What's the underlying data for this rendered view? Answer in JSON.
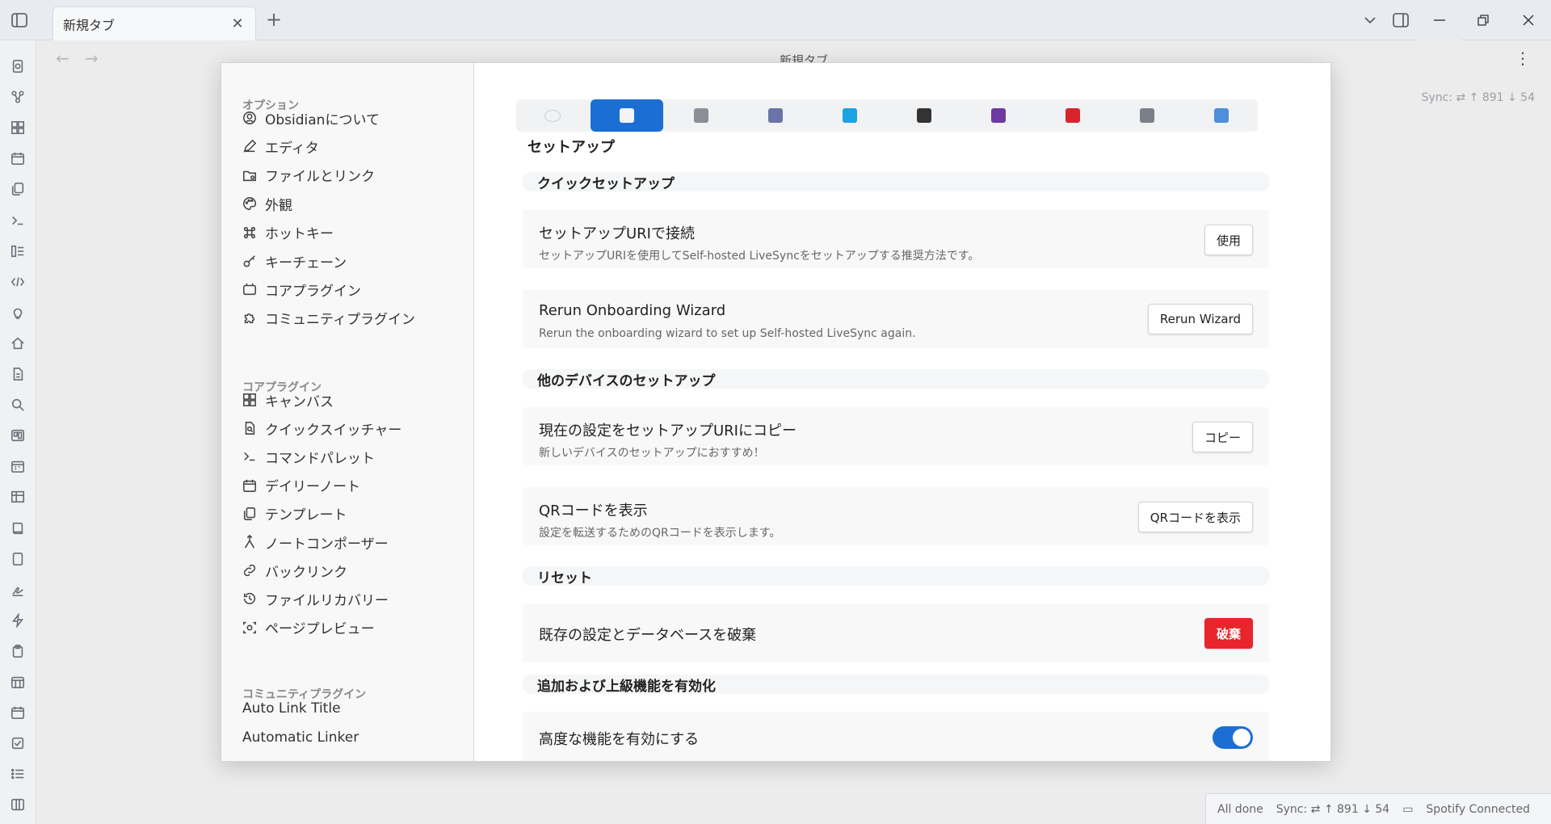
{
  "window": {
    "tab_title": "新規タブ",
    "view_title": "新規タブ"
  },
  "status": {
    "sync_top": "Sync: ⇄ ↑ 891 ↓ 54",
    "all_done": "All done",
    "sync_bottom": "Sync: ⇄ ↑ 891 ↓ 54",
    "spotify": "Spotify Connected"
  },
  "ribbon_icons": [
    "quick-switcher-icon",
    "graph-icon",
    "canvas-icon",
    "calendar-icon",
    "templates-icon",
    "terminal-icon",
    "kanban-icon",
    "code-icon",
    "lightbulb-icon",
    "home-icon",
    "document-icon",
    "search-icon",
    "board-icon",
    "calendar-grid-icon",
    "table-icon",
    "book-icon",
    "page-icon",
    "signature-icon",
    "lightning-icon",
    "clipboard-icon",
    "calendar-month-icon",
    "calendar-week-icon",
    "checkbox-icon",
    "list-icon",
    "columns-icon"
  ],
  "sidebar": {
    "options_heading": "オプション",
    "options": [
      {
        "label": "Obsidianについて",
        "icon": "account-icon"
      },
      {
        "label": "エディタ",
        "icon": "pencil-icon"
      },
      {
        "label": "ファイルとリンク",
        "icon": "folder-cog-icon"
      },
      {
        "label": "外観",
        "icon": "palette-icon"
      },
      {
        "label": "ホットキー",
        "icon": "command-icon"
      },
      {
        "label": "キーチェーン",
        "icon": "key-icon"
      },
      {
        "label": "コアプラグイン",
        "icon": "plug-box-icon"
      },
      {
        "label": "コミュニティプラグイン",
        "icon": "puzzle-icon"
      }
    ],
    "core_heading": "コアプラグイン",
    "core": [
      {
        "label": "キャンバス",
        "icon": "grid-icon"
      },
      {
        "label": "クイックスイッチャー",
        "icon": "file-search-icon"
      },
      {
        "label": "コマンドパレット",
        "icon": "terminal-icon"
      },
      {
        "label": "デイリーノート",
        "icon": "calendar-icon"
      },
      {
        "label": "テンプレート",
        "icon": "copy-icon"
      },
      {
        "label": "ノートコンポーザー",
        "icon": "merge-icon"
      },
      {
        "label": "バックリンク",
        "icon": "backlink-icon"
      },
      {
        "label": "ファイルリカバリー",
        "icon": "history-icon"
      },
      {
        "label": "ページプレビュー",
        "icon": "preview-icon"
      }
    ],
    "community_heading": "コミュニティプラグイン",
    "community": [
      {
        "label": "Auto Link Title"
      },
      {
        "label": "Automatic Linker"
      }
    ]
  },
  "pane_tabs": [
    {
      "name": "chat-tab",
      "color": "#c8ccd2"
    },
    {
      "name": "setup-tab",
      "color": "#f2f4f7"
    },
    {
      "name": "general-tab",
      "color": "#8a8f98"
    },
    {
      "name": "remote-tab",
      "color": "#6a74a8"
    },
    {
      "name": "sync-tab",
      "color": "#1aa3e0"
    },
    {
      "name": "traffic-tab",
      "color": "#333333"
    },
    {
      "name": "tool-tab",
      "color": "#6c3aa0"
    },
    {
      "name": "toolbox-tab",
      "color": "#d6262c"
    },
    {
      "name": "wrench-tab",
      "color": "#7a7f88"
    },
    {
      "name": "advanced-tab",
      "color": "#4f8ed8"
    }
  ],
  "content": {
    "section_title": "セットアップ",
    "quick_setup": "クイックセットアップ",
    "connect_uri_name": "セットアップURIで接続",
    "connect_uri_desc": "セットアップURIを使用してSelf-hosted LiveSyncをセットアップする推奨方法です。",
    "connect_uri_btn": "使用",
    "rerun_name": "Rerun Onboarding Wizard",
    "rerun_desc": "Rerun the onboarding wizard to set up Self-hosted LiveSync again.",
    "rerun_btn": "Rerun Wizard",
    "other_devices": "他のデバイスのセットアップ",
    "copy_name": "現在の設定をセットアップURIにコピー",
    "copy_desc": "新しいデバイスのセットアップにおすすめ！",
    "copy_btn": "コピー",
    "qr_name": "QRコードを表示",
    "qr_desc": "設定を転送するためのQRコードを表示します。",
    "qr_btn": "QRコードを表示",
    "reset": "リセット",
    "discard_name": "既存の設定とデータベースを破棄",
    "discard_btn": "破棄",
    "advanced_head": "追加および上級機能を有効化",
    "advanced_name": "高度な機能を有効にする",
    "advanced_on": true
  },
  "colors": {
    "accent": "#1b6fd4",
    "danger": "#e8242c"
  }
}
